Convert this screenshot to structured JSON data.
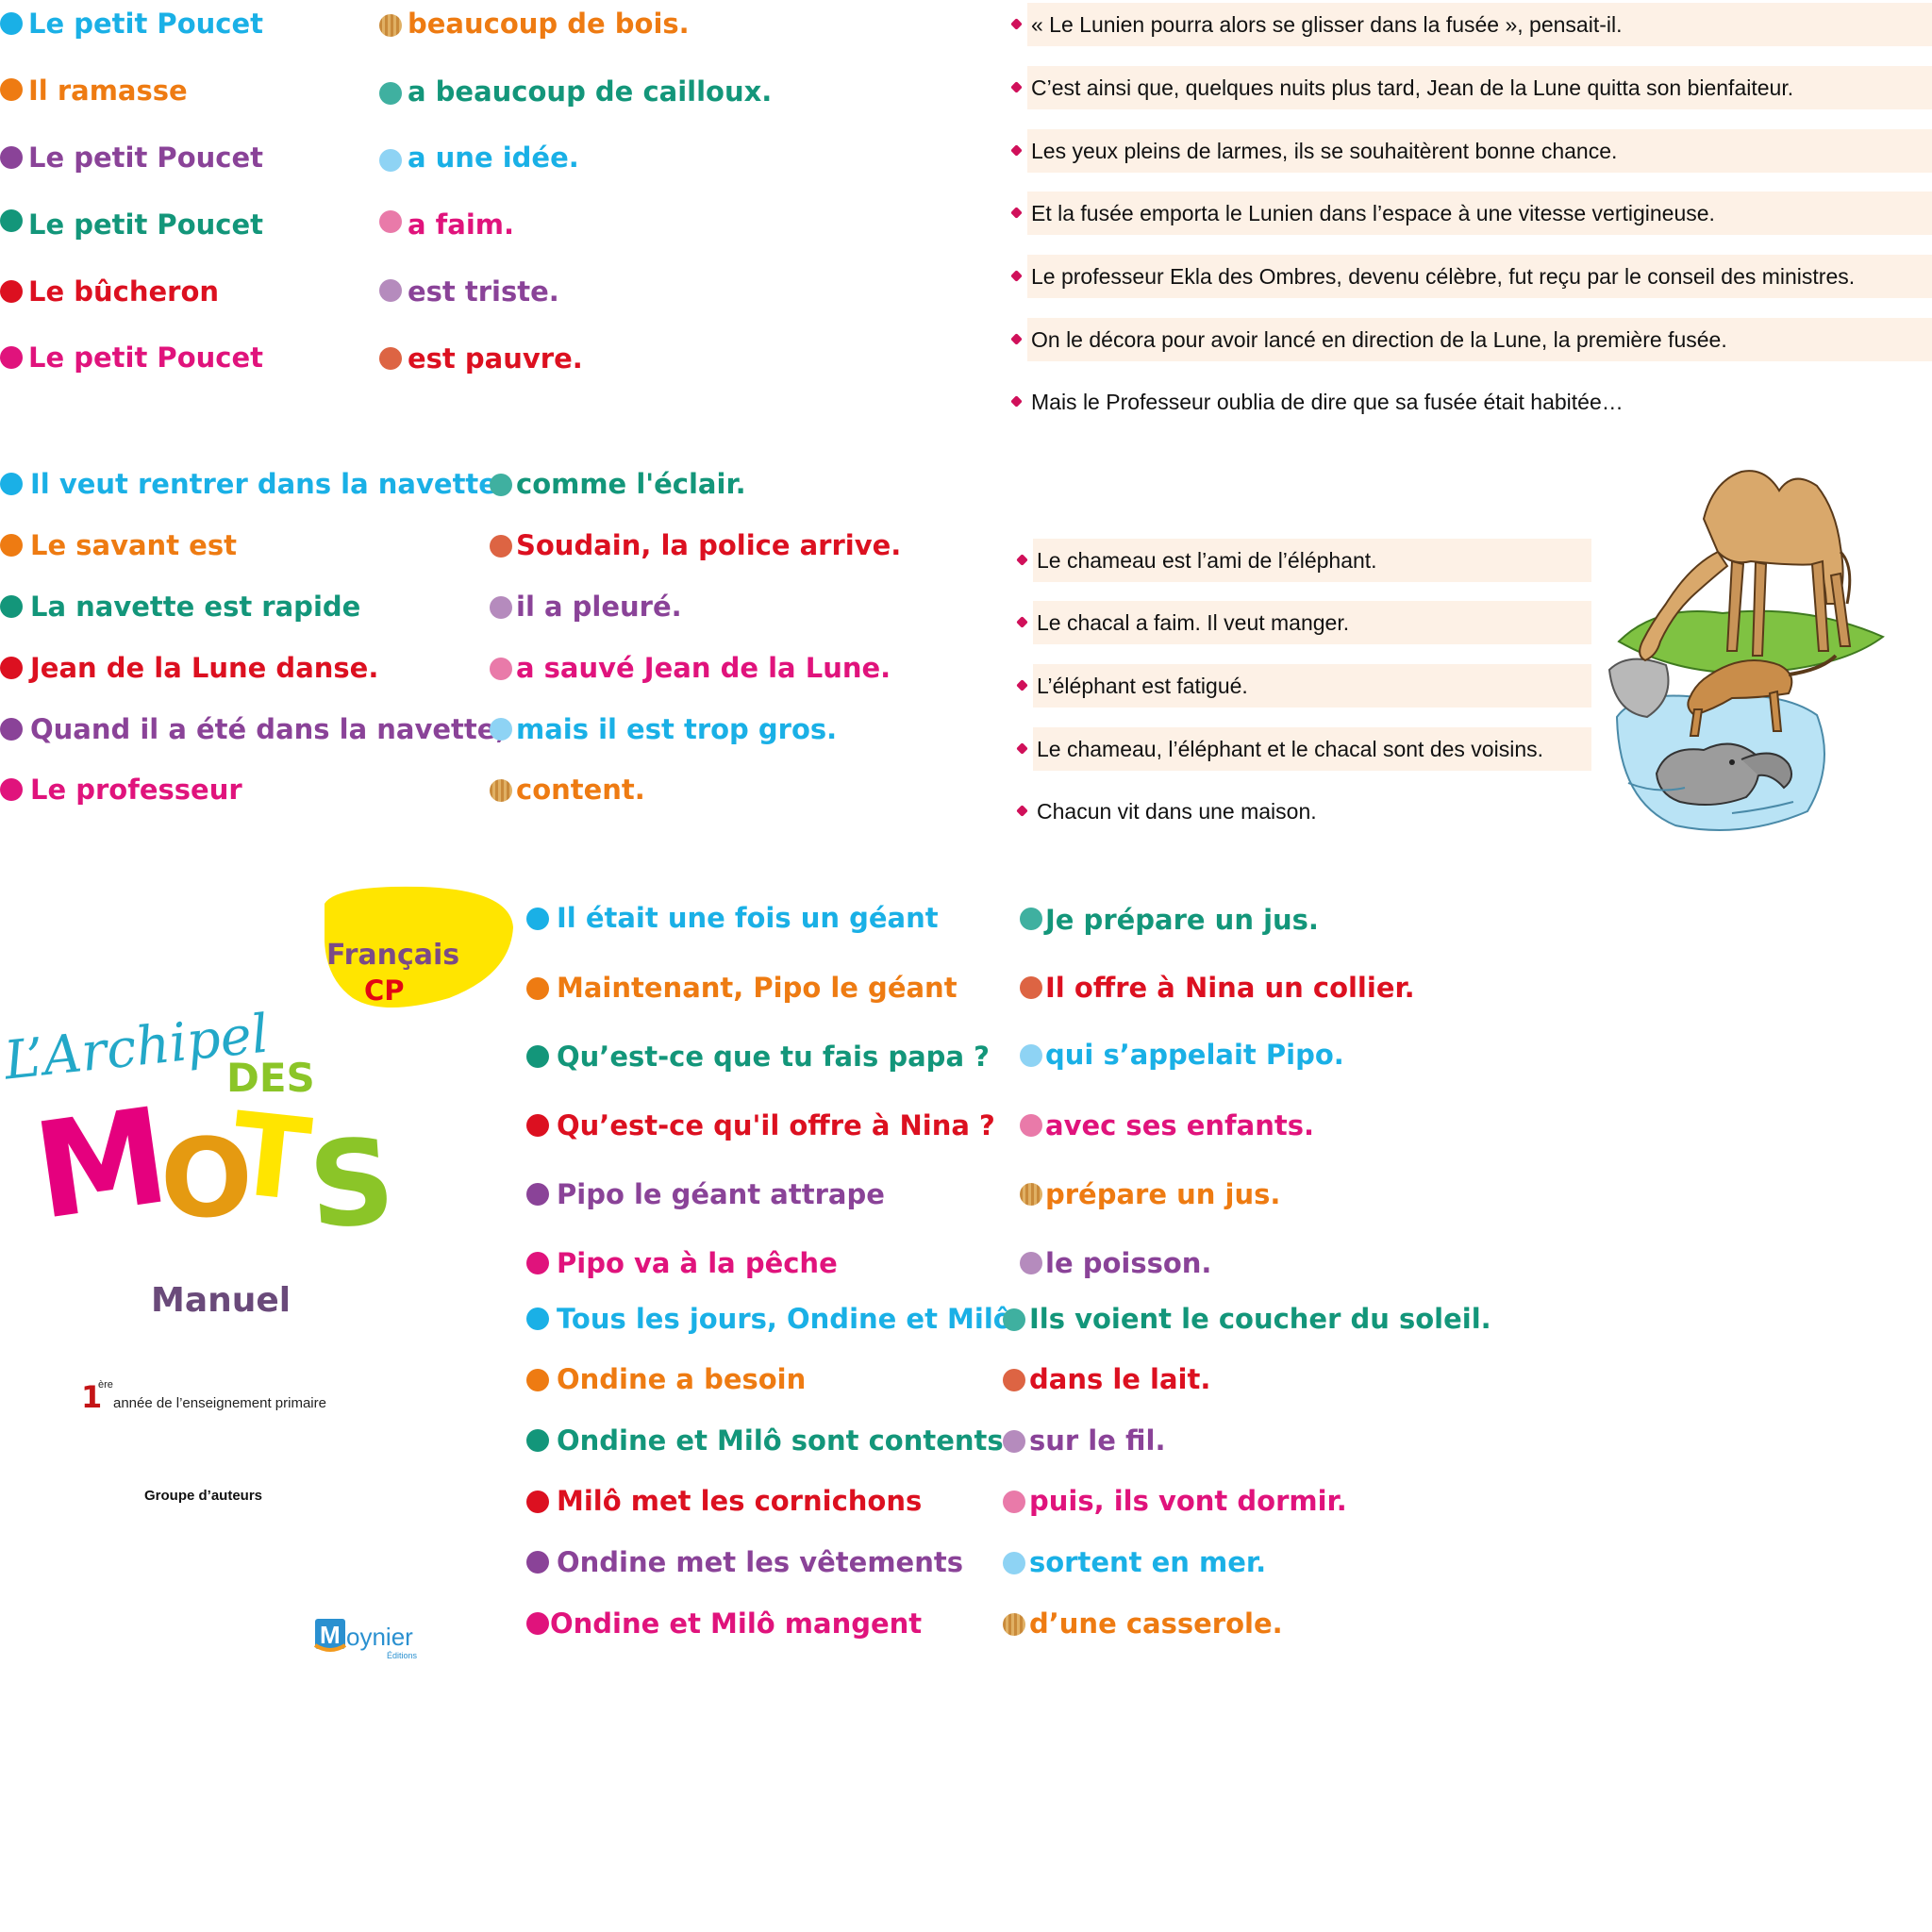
{
  "exercise1": {
    "left": [
      {
        "text": "Le petit Poucet",
        "color": "cyan"
      },
      {
        "text": "Il ramasse",
        "color": "orange"
      },
      {
        "text": "Le petit Poucet",
        "color": "purple"
      },
      {
        "text": "Le petit Poucet",
        "color": "green"
      },
      {
        "text": "Le bûcheron",
        "color": "red"
      },
      {
        "text": "Le petit Poucet",
        "color": "pink"
      }
    ],
    "right": [
      {
        "text": "beaucoup de bois.",
        "dot": "wood",
        "color": "orange"
      },
      {
        "text": "a beaucoup de cailloux.",
        "dot": "teal",
        "color": "green"
      },
      {
        "text": "a une idée.",
        "dot": "lightblue",
        "color": "cyan"
      },
      {
        "text": "a faim.",
        "dot": "rose",
        "color": "pink"
      },
      {
        "text": "est triste.",
        "dot": "lavender",
        "color": "purple"
      },
      {
        "text": "est pauvre.",
        "dot": "brick",
        "color": "red"
      }
    ]
  },
  "exercise2": {
    "left": [
      {
        "text": "Il veut rentrer dans la navette",
        "color": "cyan"
      },
      {
        "text": "Le savant est",
        "color": "orange"
      },
      {
        "text": "La navette est rapide",
        "color": "green"
      },
      {
        "text": "Jean de la Lune danse.",
        "color": "red"
      },
      {
        "text": "Quand il a été dans la navette,",
        "color": "purple"
      },
      {
        "text": "Le professeur",
        "color": "pink"
      }
    ],
    "right": [
      {
        "text": "comme l'éclair.",
        "dot": "teal",
        "color": "green"
      },
      {
        "text": "Soudain, la police arrive.",
        "dot": "brick",
        "color": "red"
      },
      {
        "text": "il a pleuré.",
        "dot": "lavender",
        "color": "purple"
      },
      {
        "text": "a sauvé Jean de la Lune.",
        "dot": "rose",
        "color": "pink"
      },
      {
        "text": "mais il est trop gros.",
        "dot": "lightblue",
        "color": "cyan"
      },
      {
        "text": "content.",
        "dot": "wood",
        "color": "orange"
      }
    ]
  },
  "story_sentences": [
    {
      "text": "« Le Lunien pourra alors se glisser dans la fusée », pensait-il.",
      "shaded": true
    },
    {
      "text": "C’est ainsi que, quelques nuits plus tard, Jean de la Lune quitta son bienfaiteur.",
      "shaded": true
    },
    {
      "text": "Les yeux pleins de larmes, ils se souhaitèrent bonne chance.",
      "shaded": true
    },
    {
      "text": "Et la fusée emporta le Lunien dans l’espace à une vitesse vertigineuse.",
      "shaded": true
    },
    {
      "text": "Le professeur Ekla des Ombres, devenu célèbre, fut reçu par le conseil des ministres.",
      "shaded": true
    },
    {
      "text": "On le décora pour avoir lancé en direction de la Lune, la première fusée.",
      "shaded": true
    },
    {
      "text": "Mais le Professeur oublia de dire que sa fusée était habitée…",
      "shaded": false
    }
  ],
  "animal_sentences": [
    {
      "text": "Le chameau est l’ami de l’éléphant.",
      "shaded": true
    },
    {
      "text": "Le chacal a faim. Il veut manger.",
      "shaded": true
    },
    {
      "text": "L’éléphant est fatigué.",
      "shaded": true
    },
    {
      "text": "Le chameau, l’éléphant et le chacal sont des voisins.",
      "shaded": true
    },
    {
      "text": "Chacun vit dans une maison.",
      "shaded": false
    }
  ],
  "exercise3": {
    "left": [
      {
        "text": "Il était une fois un géant",
        "color": "cyan"
      },
      {
        "text": "Maintenant, Pipo le géant",
        "color": "orange"
      },
      {
        "text": "Qu’est-ce que tu fais papa ?",
        "color": "green"
      },
      {
        "text": "Qu’est-ce qu'il offre à Nina ?",
        "color": "red"
      },
      {
        "text": "Pipo le géant attrape",
        "color": "purple"
      },
      {
        "text": "Pipo va à la pêche",
        "color": "pink"
      }
    ],
    "right": [
      {
        "text": "Je prépare un jus.",
        "dot": "teal",
        "color": "green"
      },
      {
        "text": "Il offre à Nina un collier.",
        "dot": "brick",
        "color": "red"
      },
      {
        "text": "qui s’appelait Pipo.",
        "dot": "lightblue",
        "color": "cyan"
      },
      {
        "text": "avec ses enfants.",
        "dot": "rose",
        "color": "pink"
      },
      {
        "text": "prépare un jus.",
        "dot": "wood",
        "color": "orange"
      },
      {
        "text": "le poisson.",
        "dot": "lavender",
        "color": "purple"
      }
    ]
  },
  "exercise4": {
    "left": [
      {
        "text": "Tous les jours, Ondine et Milô",
        "color": "cyan"
      },
      {
        "text": "Ondine a besoin",
        "color": "orange"
      },
      {
        "text": "Ondine et Milô sont contents.",
        "color": "green"
      },
      {
        "text": "Milô met les cornichons",
        "color": "red"
      },
      {
        "text": "Ondine met les vêtements",
        "color": "purple"
      },
      {
        "text": "Ondine et Milô mangent",
        "color": "pink"
      }
    ],
    "right": [
      {
        "text": "Ils voient le coucher du soleil.",
        "dot": "teal",
        "color": "green"
      },
      {
        "text": "dans le lait.",
        "dot": "brick",
        "color": "red"
      },
      {
        "text": "sur le fil.",
        "dot": "lavender",
        "color": "purple"
      },
      {
        "text": "puis, ils vont dormir.",
        "dot": "rose",
        "color": "pink"
      },
      {
        "text": "sortent en mer.",
        "dot": "lightblue",
        "color": "cyan"
      },
      {
        "text": "d’une casserole.",
        "dot": "wood",
        "color": "orange"
      }
    ]
  },
  "cover": {
    "badge_line1": "Français",
    "badge_line2": "CP",
    "title_part1": "L’Archipel",
    "title_part2": "DES",
    "title_letters": [
      "M",
      "O",
      "T",
      "S"
    ],
    "subtitle": "Manuel",
    "grade_number": "1",
    "grade_suffix": "ère",
    "grade_text": "année de l’enseignement primaire",
    "authors": "Groupe d’auteurs",
    "publisher_initial": "M",
    "publisher_rest": "oynier",
    "publisher_sub": "Éditions"
  },
  "colors": {
    "cyan": "#1ab0e6",
    "orange": "#ee7b12",
    "purple": "#8a4398",
    "green": "#13967a",
    "red": "#dc1020",
    "pink": "#e0137c",
    "sentence_shading": "#fdf1e6",
    "bullet": "#d0105a",
    "badge_yellow": "#ffe500"
  }
}
